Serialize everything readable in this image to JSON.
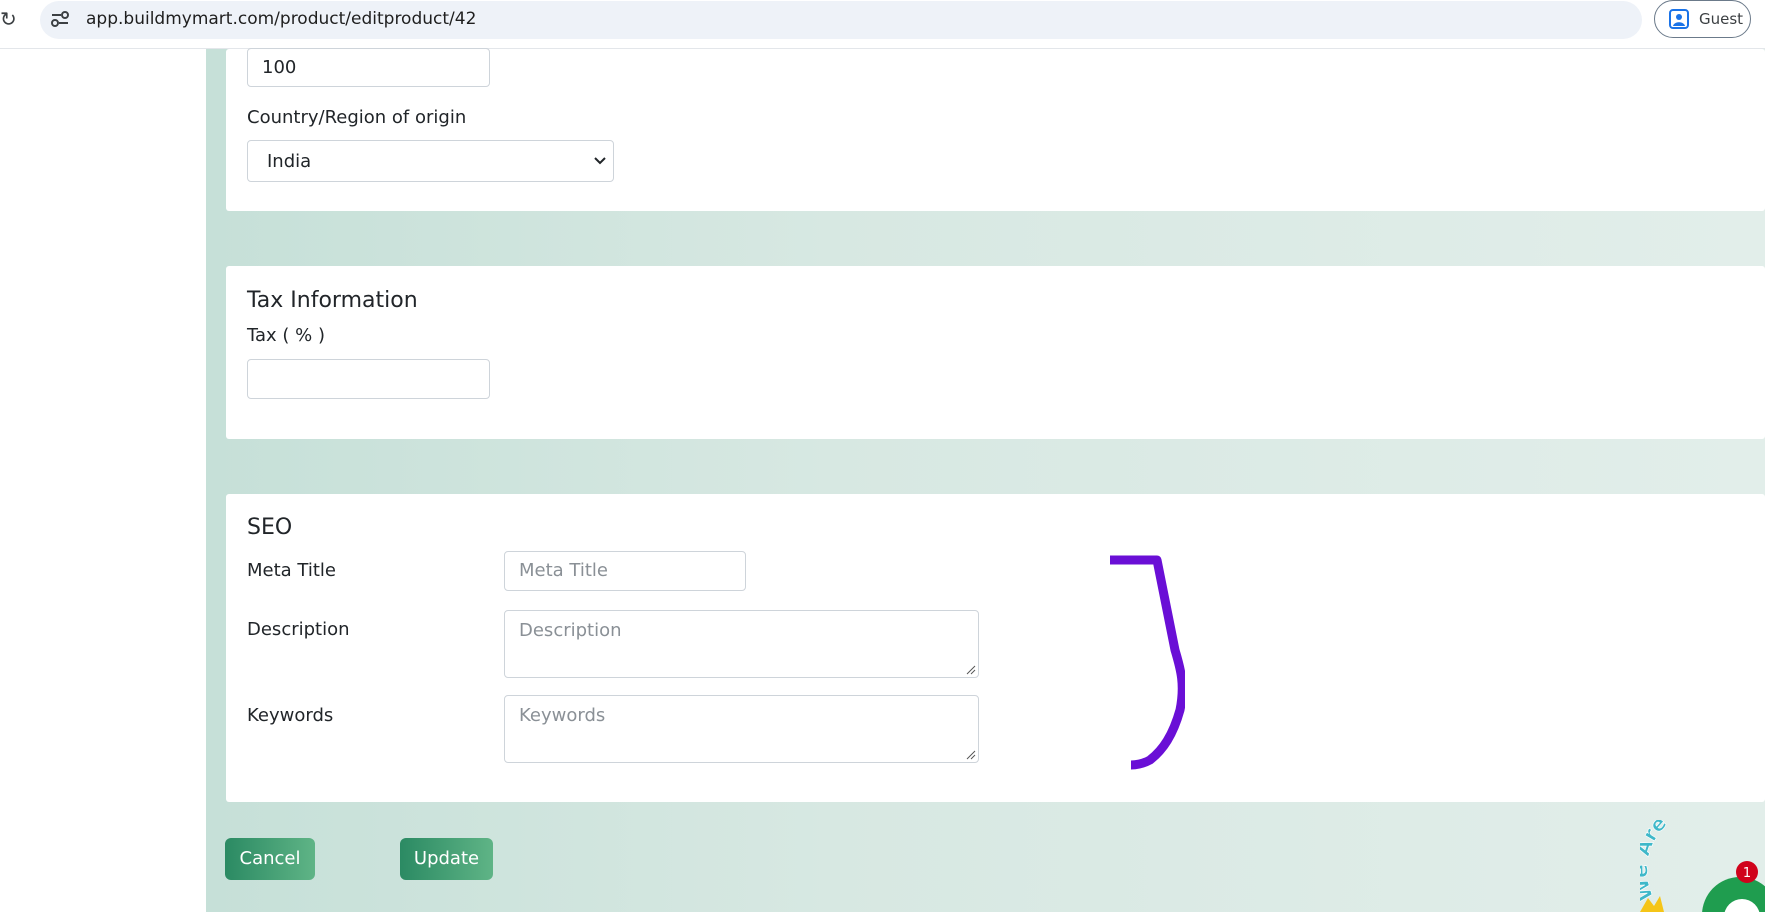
{
  "browser": {
    "url": "app.buildmymart.com/product/editproduct/42",
    "profile_label": "Guest"
  },
  "inventory": {
    "quantity_value": "100",
    "country_label": "Country/Region of origin",
    "country_selected": "India"
  },
  "tax": {
    "title": "Tax Information",
    "tax_label": "Tax ( % )",
    "tax_value": ""
  },
  "seo": {
    "title": "SEO",
    "meta_title_label": "Meta Title",
    "meta_title_placeholder": "Meta Title",
    "description_label": "Description",
    "description_placeholder": "Description",
    "keywords_label": "Keywords",
    "keywords_placeholder": "Keywords"
  },
  "actions": {
    "cancel_label": "Cancel",
    "update_label": "Update"
  },
  "chat": {
    "banner_text": "We Are Here",
    "badge_count": "1"
  },
  "colors": {
    "accent_green": "#2b8a63",
    "annotation_purple": "#6a0fd6",
    "badge_red": "#d0021b"
  }
}
